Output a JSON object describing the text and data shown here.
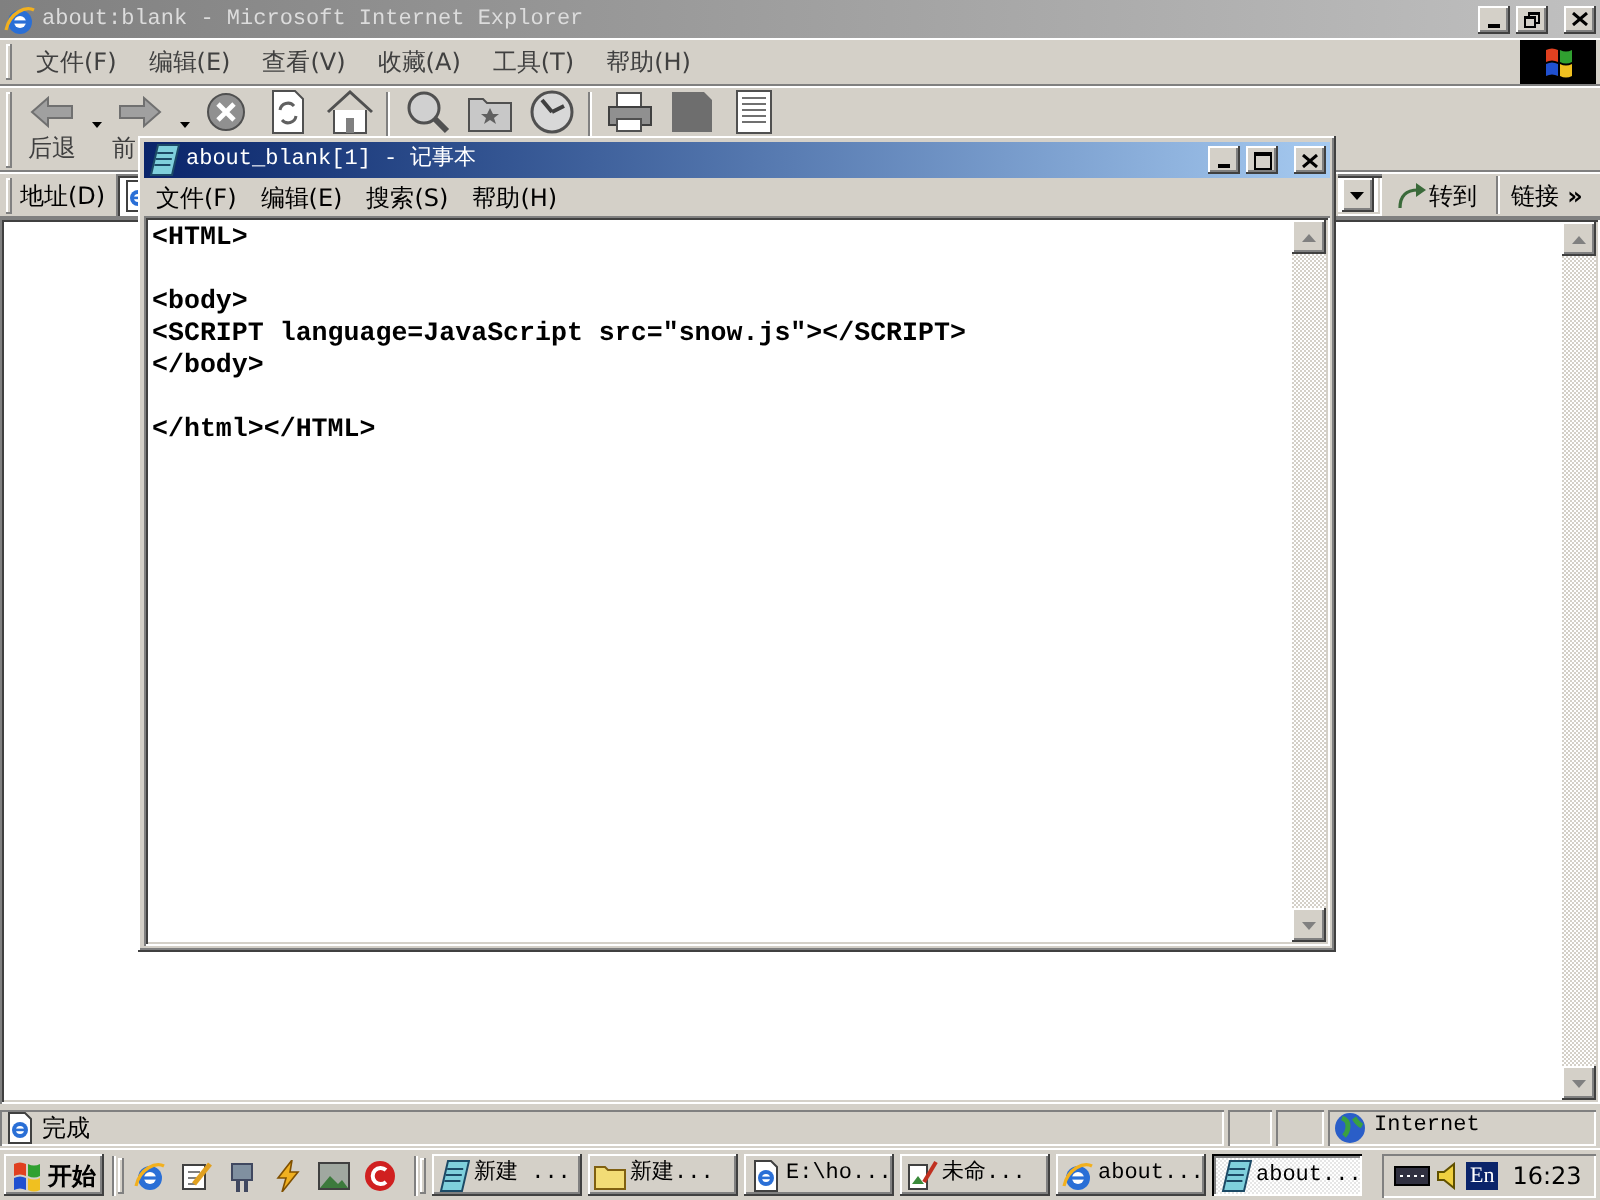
{
  "browser_window": {
    "title": "about:blank - Microsoft Internet Explorer",
    "active": false,
    "menu": [
      "文件(F)",
      "编辑(E)",
      "查看(V)",
      "收藏(A)",
      "工具(T)",
      "帮助(H)"
    ],
    "toolbar": [
      {
        "kind": "back",
        "label": "后退"
      },
      {
        "kind": "forward",
        "label": "前"
      },
      {
        "kind": "stop"
      },
      {
        "kind": "refresh"
      },
      {
        "kind": "home"
      },
      {
        "kind": "separator"
      },
      {
        "kind": "search"
      },
      {
        "kind": "favorites"
      },
      {
        "kind": "history"
      },
      {
        "kind": "separator"
      },
      {
        "kind": "print"
      },
      {
        "kind": "edit"
      },
      {
        "kind": "discuss"
      }
    ],
    "address_bar": {
      "label": "地址(D)",
      "go_button": "转到",
      "links": "链接",
      "chevron": "»"
    },
    "status_bar": {
      "text": "完成",
      "zone": "Internet"
    }
  },
  "notepad_window": {
    "title": "about_blank[1] - 记事本",
    "active": true,
    "menu": [
      "文件(F)",
      "编辑(E)",
      "搜索(S)",
      "帮助(H)"
    ],
    "text": "<HTML>\n\n<body>\n<SCRIPT language=JavaScript src=\"snow.js\"></SCRIPT>\n</body>\n\n</html></HTML>"
  },
  "taskbar": {
    "start_button": "开始",
    "tasks": [
      {
        "kind": "notepad",
        "label": "新建 ...",
        "selected": false
      },
      {
        "kind": "folder",
        "label": "新建...",
        "selected": false
      },
      {
        "kind": "browser-page",
        "label": "E:\\ho...",
        "selected": false
      },
      {
        "kind": "paint",
        "label": "未命...",
        "selected": false
      },
      {
        "kind": "browser",
        "label": "about...",
        "selected": false
      },
      {
        "kind": "notepad",
        "label": "about...",
        "selected": true
      }
    ],
    "tray": {
      "input_language": "En",
      "clock": "16:23"
    }
  }
}
